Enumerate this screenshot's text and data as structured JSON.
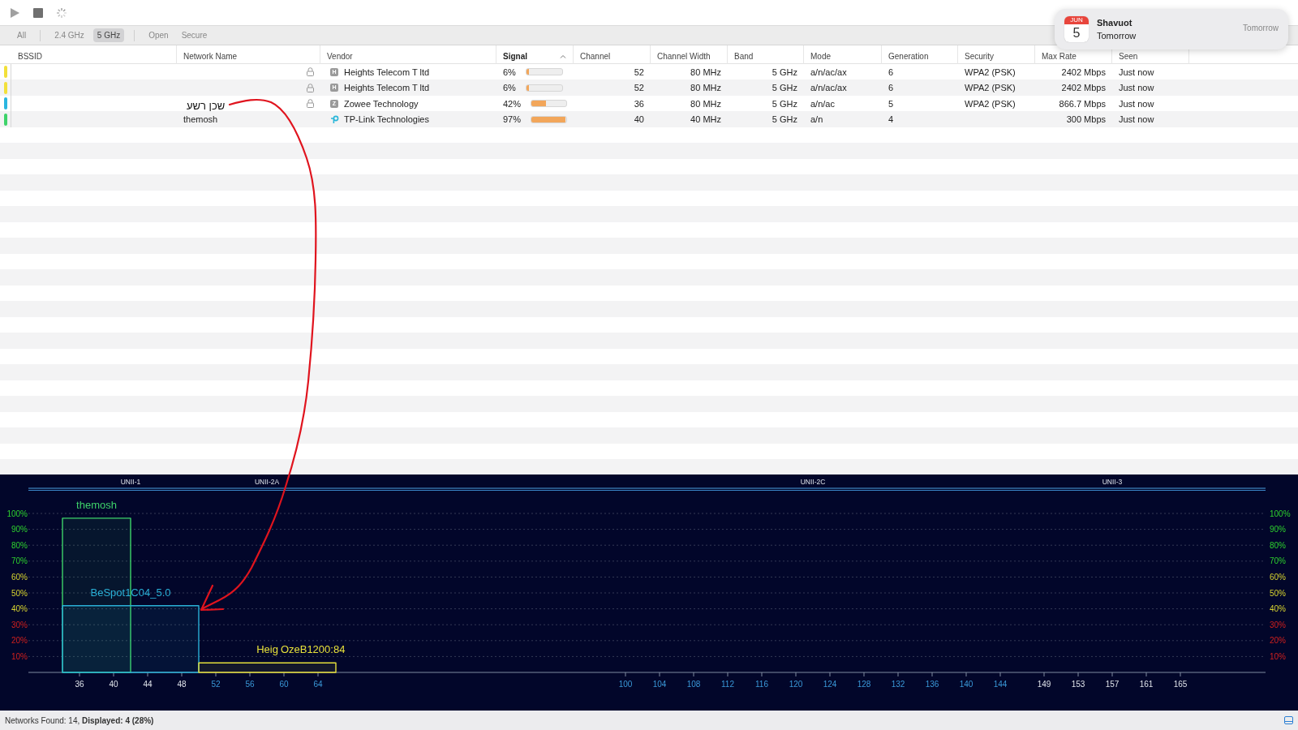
{
  "toolbar": {
    "buttons": [
      {
        "kind": "play"
      },
      {
        "kind": "stop"
      },
      {
        "kind": "spinner"
      }
    ]
  },
  "filters": [
    {
      "label": "All",
      "selected": false
    },
    {
      "label": "2.4 GHz",
      "selected": false
    },
    {
      "label": "5 GHz",
      "selected": true
    },
    {
      "label": "Open",
      "selected": false
    },
    {
      "label": "Secure",
      "selected": false
    }
  ],
  "table": {
    "columns": [
      {
        "label": "BSSID",
        "sorted": false
      },
      {
        "label": "Network Name",
        "sorted": false
      },
      {
        "label": "Vendor",
        "sorted": false
      },
      {
        "label": "Signal",
        "sorted": true
      },
      {
        "label": "Channel",
        "sorted": false
      },
      {
        "label": "Channel Width",
        "sorted": false
      },
      {
        "label": "Band",
        "sorted": false
      },
      {
        "label": "Mode",
        "sorted": false
      },
      {
        "label": "Generation",
        "sorted": false
      },
      {
        "label": "Security",
        "sorted": false
      },
      {
        "label": "Max Rate",
        "sorted": false
      },
      {
        "label": "Seen",
        "sorted": false
      }
    ],
    "rows": [
      {
        "color": "#f2e03a",
        "locked": true,
        "kind": "letter",
        "vendor_badge": "H",
        "vendor": "Heights Telecom T ltd",
        "signal": "6%",
        "level": 0.06,
        "channel": "52",
        "channel_width": "80 MHz",
        "band": "5 GHz",
        "mode": "a/n/ac/ax",
        "generation": "6",
        "security": "WPA2 (PSK)",
        "max_rate": "2402 Mbps",
        "seen": "Just now"
      },
      {
        "color": "#f2e03a",
        "locked": true,
        "kind": "letter",
        "vendor_badge": "H",
        "vendor": "Heights Telecom T ltd",
        "signal": "6%",
        "level": 0.06,
        "channel": "52",
        "channel_width": "80 MHz",
        "band": "5 GHz",
        "mode": "a/n/ac/ax",
        "generation": "6",
        "security": "WPA2 (PSK)",
        "max_rate": "2402 Mbps",
        "seen": "Just now"
      },
      {
        "color": "#2ab6e0",
        "locked": true,
        "kind": "letter",
        "vendor_badge": "Z",
        "vendor": "Zowee Technology",
        "signal": "42%",
        "level": 0.42,
        "channel": "36",
        "channel_width": "80 MHz",
        "band": "5 GHz",
        "mode": "a/n/ac",
        "generation": "5",
        "security": "WPA2 (PSK)",
        "max_rate": "866.7 Mbps",
        "seen": "Just now"
      },
      {
        "color": "#3ed36a",
        "name": "themosh",
        "locked": false,
        "kind": "logo",
        "vendor": "TP-Link Technologies",
        "signal": "97%",
        "level": 0.97,
        "channel": "40",
        "channel_width": "40 MHz",
        "band": "5 GHz",
        "mode": "a/n",
        "generation": "4",
        "max_rate": "300 Mbps",
        "seen": "Just now"
      }
    ]
  },
  "channel_graph": {
    "chart_data": {
      "type": "area",
      "x": [
        34,
        36,
        40,
        42,
        44,
        48,
        50,
        52,
        56,
        60,
        64,
        66
      ],
      "series": [
        {
          "name": "themosh",
          "color": "#3ed36a",
          "values": [
            97,
            97,
            97,
            97,
            null,
            null,
            null,
            null,
            null,
            null,
            null,
            null
          ]
        },
        {
          "name": "BeSpot1C04_5.0",
          "color": "#2ab0d6",
          "values": [
            42,
            42,
            42,
            42,
            42,
            42,
            42,
            null,
            null,
            null,
            null,
            null
          ]
        },
        {
          "name": "Heig",
          "color": "#e6e03a",
          "values": [
            null,
            null,
            null,
            null,
            null,
            null,
            6,
            6,
            6,
            6,
            6,
            6
          ]
        }
      ],
      "xlim": [
        30,
        175
      ],
      "ylim": [
        0,
        100
      ],
      "y2lim": [
        0,
        100
      ],
      "grid": true,
      "yticks": [
        {
          "value": 100,
          "label": "100%"
        },
        {
          "value": 90,
          "label": "90%"
        },
        {
          "value": 80,
          "label": "80%"
        },
        {
          "value": 70,
          "label": "70%"
        },
        {
          "value": 60,
          "label": "60%"
        },
        {
          "value": 50,
          "label": "50%"
        },
        {
          "value": 40,
          "label": "40%"
        },
        {
          "value": 30,
          "label": "30%"
        },
        {
          "value": 20,
          "label": "20%"
        },
        {
          "value": 10,
          "label": "10%"
        }
      ],
      "y2ticks": [
        {
          "value": 100,
          "label": "100%"
        },
        {
          "value": 90,
          "label": "90%"
        },
        {
          "value": 80,
          "label": "80%"
        },
        {
          "value": 70,
          "label": "70%"
        },
        {
          "value": 60,
          "label": "60%"
        },
        {
          "value": 50,
          "label": "50%"
        },
        {
          "value": 40,
          "label": "40%"
        },
        {
          "value": 30,
          "label": "30%"
        },
        {
          "value": 20,
          "label": "20%"
        },
        {
          "value": 10,
          "label": "10%"
        }
      ],
      "xticks": [
        36,
        40,
        44,
        48,
        52,
        56,
        60,
        64,
        100,
        104,
        108,
        112,
        116,
        120,
        124,
        128,
        132,
        136,
        140,
        144,
        149,
        153,
        157,
        161,
        165
      ],
      "annotations": [
        "UNII-1",
        "UNII-2A",
        "UNII-2C",
        "UNII-3",
        "OzeB1200:84"
      ]
    }
  },
  "status_bar": {
    "text": "Networks Found: 14, **Displayed: 4 (28%)**"
  },
  "notification": {
    "month": "JUN",
    "day": "5",
    "title": "Shavuot",
    "subtitle": "Tomorrow",
    "time": "Tomorrow"
  },
  "annotation": {
    "text": "שכן רשע"
  }
}
